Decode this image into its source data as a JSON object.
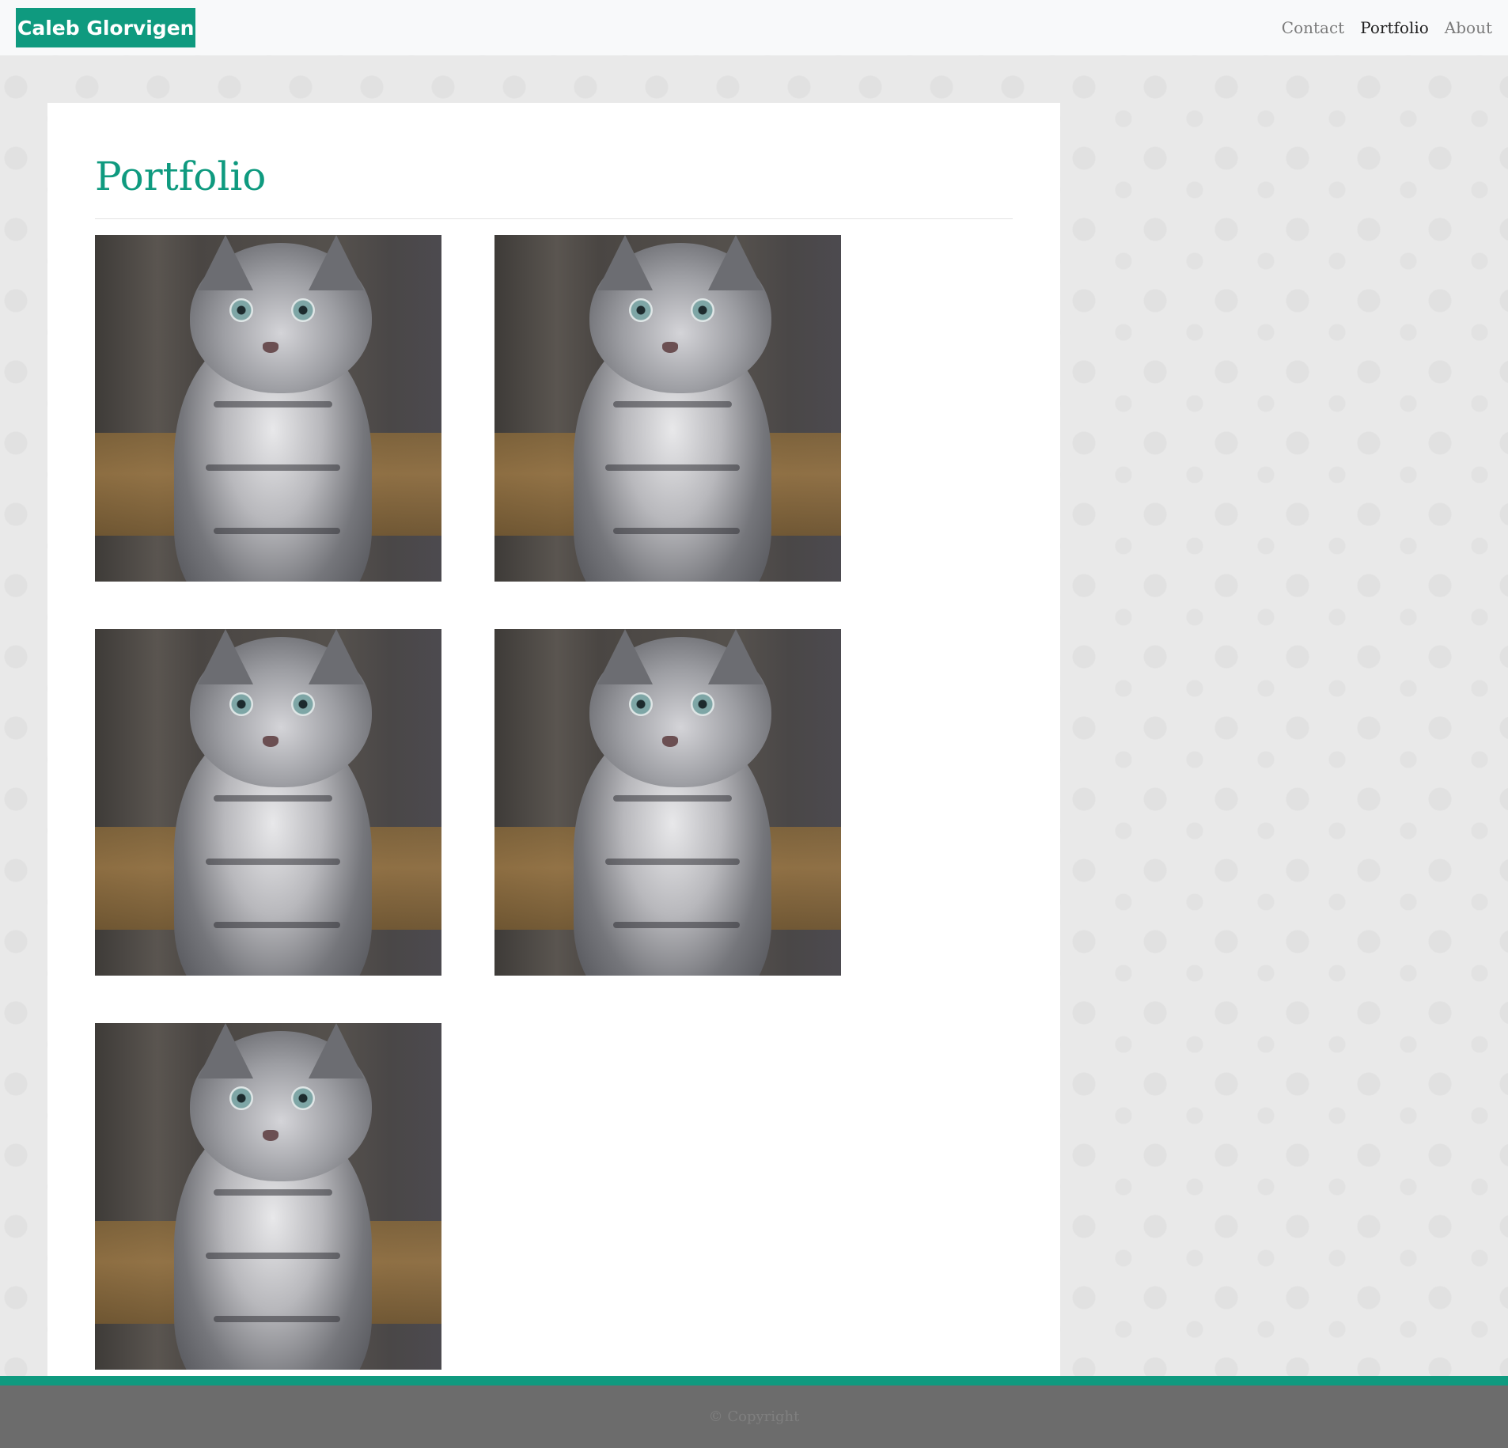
{
  "navbar": {
    "brand": "Caleb Glorvigen",
    "links": [
      {
        "label": "Contact"
      },
      {
        "label": "Portfolio"
      },
      {
        "label": "About"
      }
    ],
    "active": "Portfolio"
  },
  "main": {
    "title": "Portfolio",
    "gallery": [
      {
        "subject": "gray tabby kitten"
      },
      {
        "subject": "gray tabby kitten"
      },
      {
        "subject": "gray tabby kitten"
      },
      {
        "subject": "gray tabby kitten"
      },
      {
        "subject": "gray tabby kitten"
      }
    ]
  },
  "footer": {
    "copyright": "© Copyright"
  },
  "colors": {
    "accent": "#0f9a7f",
    "navbar_bg": "#f8f9fa",
    "page_bg": "#e9e9e9",
    "footer_bg": "#6c6c6c"
  }
}
